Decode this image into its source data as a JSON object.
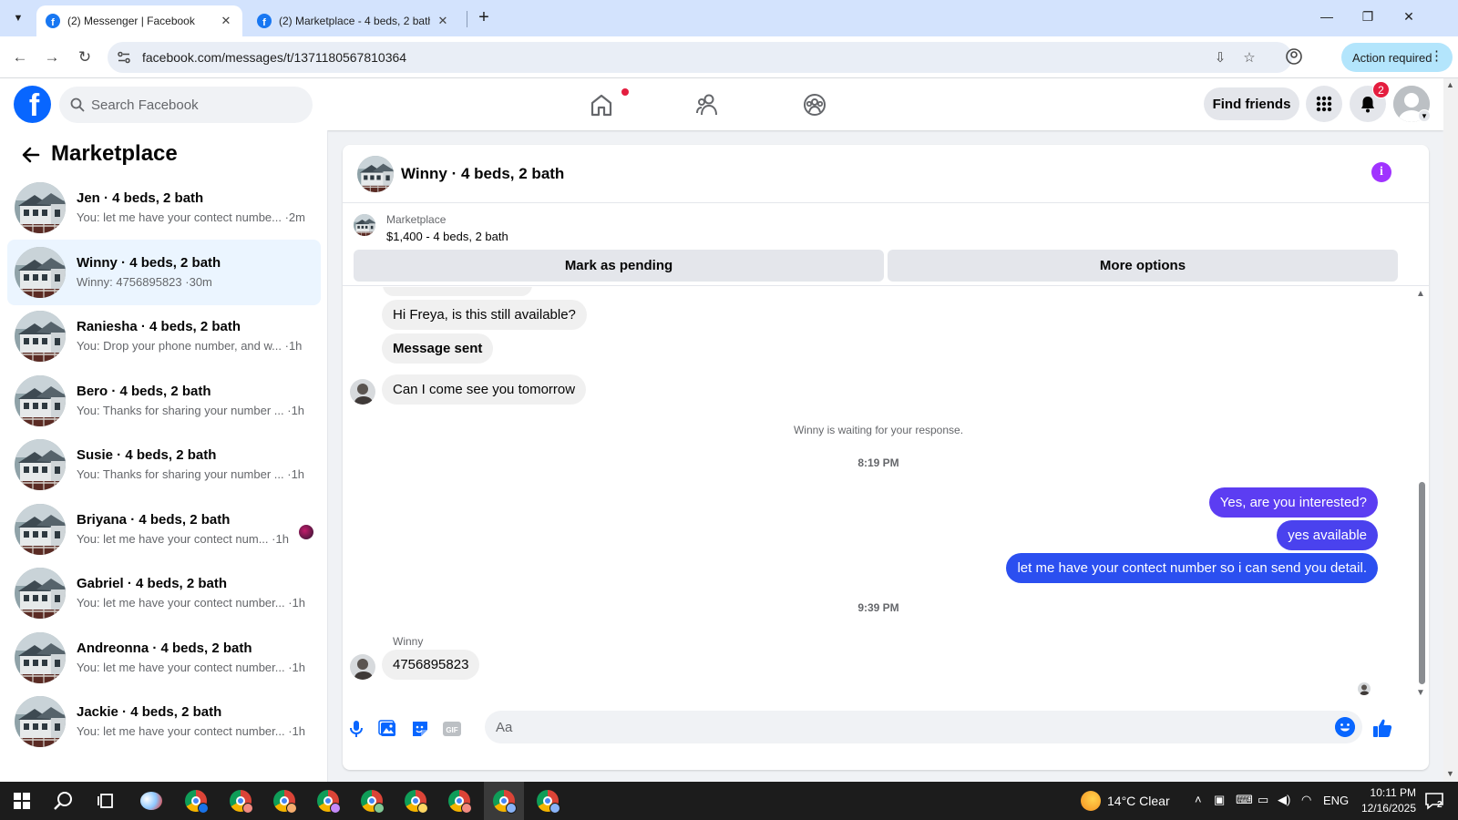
{
  "browser": {
    "tabs": [
      {
        "label": "(2) Messenger | Facebook",
        "active": true
      },
      {
        "label": "(2) Marketplace - 4 beds, 2 bath",
        "active": false
      }
    ],
    "url": "facebook.com/messages/t/1371180567810364",
    "action_required": "Action required"
  },
  "fb": {
    "search_placeholder": "Search Facebook",
    "find_friends": "Find friends",
    "notification_count": "2",
    "accent": "#0866ff"
  },
  "sidebar": {
    "title": "Marketplace",
    "conversations": [
      {
        "name": "Jen · 4 beds, 2 bath",
        "preview": "You: let me have your contect numbe... ·2m",
        "selected": false
      },
      {
        "name": "Winny · 4 beds, 2 bath",
        "preview": "Winny: 4756895823 ·30m",
        "selected": true
      },
      {
        "name": "Raniesha · 4 beds, 2 bath",
        "preview": "You: Drop your phone number, and w... ·1h",
        "selected": false
      },
      {
        "name": "Bero · 4 beds, 2 bath",
        "preview": "You: Thanks for sharing your number ... ·1h",
        "selected": false
      },
      {
        "name": "Susie · 4 beds, 2 bath",
        "preview": "You: Thanks for sharing your number ... ·1h",
        "selected": false
      },
      {
        "name": "Briyana · 4 beds, 2 bath",
        "preview": "You: let me have your contect num... ·1h",
        "selected": false
      },
      {
        "name": "Gabriel · 4 beds, 2 bath",
        "preview": "You: let me have your contect number... ·1h",
        "selected": false
      },
      {
        "name": "Andreonna · 4 beds, 2 bath",
        "preview": "You: let me have your contect number... ·1h",
        "selected": false
      },
      {
        "name": "Jackie · 4 beds, 2 bath",
        "preview": "You: let me have your contect number... ·1h",
        "selected": false
      }
    ]
  },
  "chat": {
    "title": "Winny · 4 beds, 2 bath",
    "listing_label": "Marketplace",
    "listing_title": "$1,400 - 4 beds, 2 bath",
    "mark_pending": "Mark as pending",
    "more_options": "More options",
    "messages": {
      "in1": "Hi Freya, is this still available?",
      "in2": "Message sent",
      "in3": "Can I come see you tomorrow",
      "waiting": "Winny is waiting for your response.",
      "time1": "8:19 PM",
      "out1": "Yes, are you interested?",
      "out2": "yes available",
      "out3": "let me have your contect number so i can send you detail.",
      "time2": "9:39 PM",
      "sender": "Winny",
      "in4": "4756895823"
    },
    "composer_placeholder": "Aa",
    "outgoing_color": "#5c3df2"
  },
  "taskbar": {
    "weather": "14°C  Clear",
    "lang": "ENG",
    "time": "10:11 PM",
    "date": "12/16/2025",
    "notif": "2"
  }
}
